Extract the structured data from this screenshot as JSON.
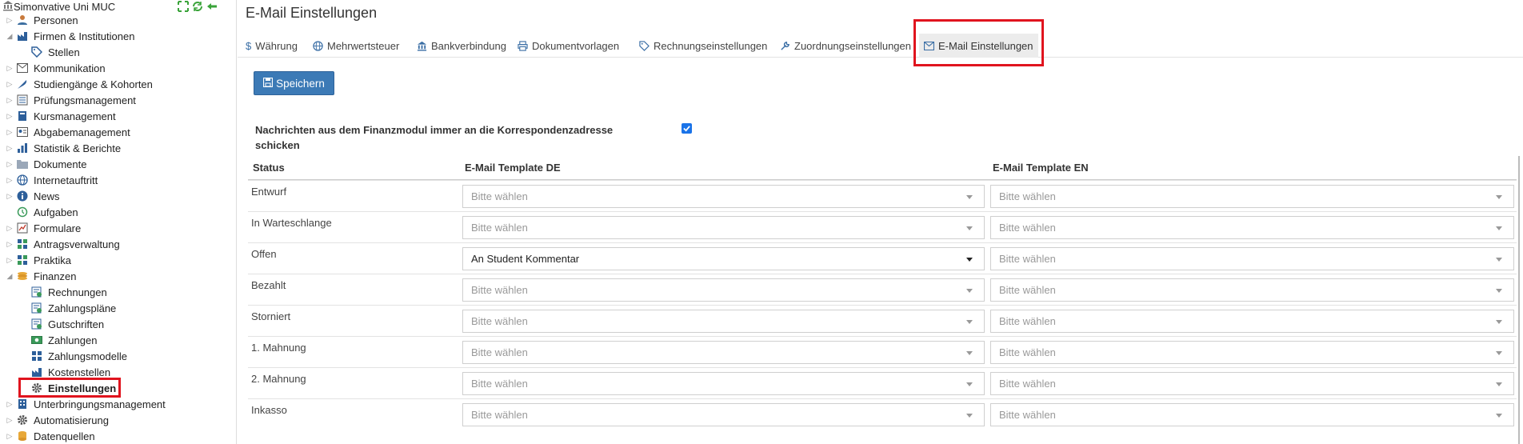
{
  "sidebar": {
    "root_label": "Simonvative Uni MUC",
    "items": [
      {
        "label": "Personen"
      },
      {
        "label": "Firmen & Institutionen"
      },
      {
        "label": "Stellen"
      },
      {
        "label": "Kommunikation"
      },
      {
        "label": "Studiengänge & Kohorten"
      },
      {
        "label": "Prüfungsmanagement"
      },
      {
        "label": "Kursmanagement"
      },
      {
        "label": "Abgabemanagement"
      },
      {
        "label": "Statistik & Berichte"
      },
      {
        "label": "Dokumente"
      },
      {
        "label": "Internetauftritt"
      },
      {
        "label": "News"
      },
      {
        "label": "Aufgaben"
      },
      {
        "label": "Formulare"
      },
      {
        "label": "Antragsverwaltung"
      },
      {
        "label": "Praktika"
      },
      {
        "label": "Finanzen"
      },
      {
        "label": "Rechnungen"
      },
      {
        "label": "Zahlungspläne"
      },
      {
        "label": "Gutschriften"
      },
      {
        "label": "Zahlungen"
      },
      {
        "label": "Zahlungsmodelle"
      },
      {
        "label": "Kostenstellen"
      },
      {
        "label": "Einstellungen"
      },
      {
        "label": "Unterbringungsmanagement"
      },
      {
        "label": "Automatisierung"
      },
      {
        "label": "Datenquellen"
      }
    ],
    "selected": "Einstellungen"
  },
  "main": {
    "title": "E-Mail Einstellungen",
    "tabs": [
      {
        "label": "Währung",
        "icon": "dollar-icon"
      },
      {
        "label": "Mehrwertsteuer",
        "icon": "globe-icon"
      },
      {
        "label": "Bankverbindung",
        "icon": "bank-icon"
      },
      {
        "label": "Dokumentvorlagen",
        "icon": "printer-icon"
      },
      {
        "label": "Rechnungseinstellungen",
        "icon": "tag-icon"
      },
      {
        "label": "Zuordnungseinstellungen",
        "icon": "wrench-icon"
      },
      {
        "label": "E-Mail Einstellungen",
        "icon": "envelope-icon",
        "active": true
      }
    ],
    "save_label": "Speichern",
    "option_label": "Nachrichten aus dem Finanzmodul immer an die Korrespondenzadresse schicken",
    "option_checked": true,
    "table": {
      "headers": {
        "status": "Status",
        "de": "E-Mail Template DE",
        "en": "E-Mail Template EN"
      },
      "rows": [
        {
          "status": "Entwurf",
          "de": "Bitte wählen",
          "en": "Bitte wählen"
        },
        {
          "status": "In Warteschlange",
          "de": "Bitte wählen",
          "en": "Bitte wählen"
        },
        {
          "status": "Offen",
          "de": "An Student Kommentar",
          "en": "Bitte wählen"
        },
        {
          "status": "Bezahlt",
          "de": "Bitte wählen",
          "en": "Bitte wählen"
        },
        {
          "status": "Storniert",
          "de": "Bitte wählen",
          "en": "Bitte wählen"
        },
        {
          "status": "1. Mahnung",
          "de": "Bitte wählen",
          "en": "Bitte wählen"
        },
        {
          "status": "2. Mahnung",
          "de": "Bitte wählen",
          "en": "Bitte wählen"
        },
        {
          "status": "Inkasso",
          "de": "Bitte wählen",
          "en": "Bitte wählen"
        }
      ]
    }
  },
  "colors": {
    "accent": "#3c7ab6",
    "highlight": "#e0141e",
    "checkbox": "#1a73e8"
  }
}
